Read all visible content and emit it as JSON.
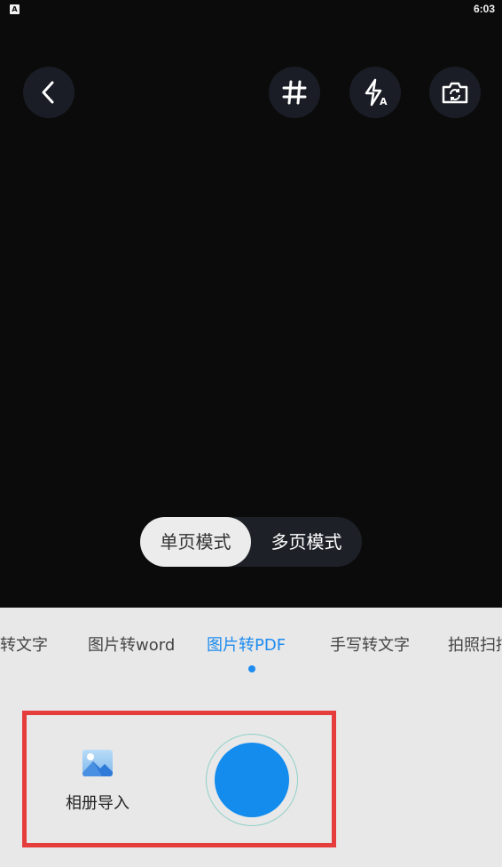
{
  "status_bar": {
    "indicator": "A",
    "time": "6:03"
  },
  "toolbar": {
    "back_icon": "back-icon",
    "grid_icon": "grid-icon",
    "flash_icon": "flash-auto-icon",
    "flip_icon": "flip-camera-icon"
  },
  "mode_toggle": {
    "single": "单页模式",
    "multi": "多页模式",
    "selected": "单页模式"
  },
  "tabs": [
    {
      "label": "转文字"
    },
    {
      "label": "图片转word"
    },
    {
      "label": "图片转PDF",
      "active": true
    },
    {
      "label": "手写转文字"
    },
    {
      "label": "拍照扫描"
    }
  ],
  "album": {
    "label": "相册导入",
    "icon": "image-icon"
  },
  "shutter": {
    "icon": "shutter-button"
  },
  "colors": {
    "accent": "#1d8bf0",
    "highlight": "#e53c3c",
    "camera_bg": "#0b0b0b"
  }
}
